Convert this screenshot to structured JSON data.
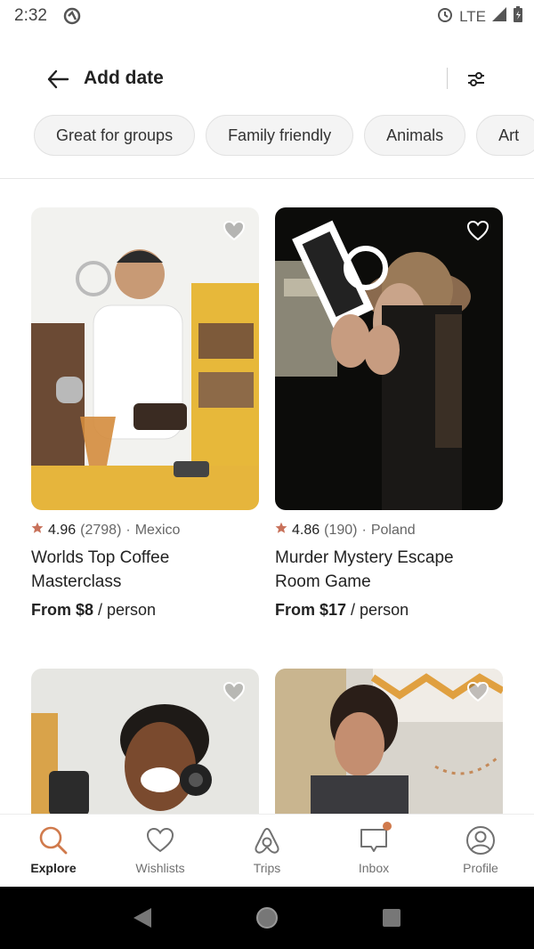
{
  "status_bar": {
    "time": "2:32",
    "network": "LTE"
  },
  "header": {
    "title": "Add date"
  },
  "chips": [
    "Great for groups",
    "Family friendly",
    "Animals",
    "Art"
  ],
  "colors": {
    "accent": "#d07a4c",
    "star": "#c8715a"
  },
  "cards": [
    {
      "rating": "4.96",
      "reviews": "(2798)",
      "country": "Mexico",
      "title_line1": "Worlds Top Coffee",
      "title_line2": "Masterclass",
      "price_from": "From $8",
      "price_unit": " / person"
    },
    {
      "rating": "4.86",
      "reviews": "(190)",
      "country": "Poland",
      "title_line1": "Murder Mystery Escape",
      "title_line2": "Room Game",
      "price_from": "From $17",
      "price_unit": " / person"
    },
    {
      "rating": "",
      "reviews": "",
      "country": "",
      "title_line1": "",
      "title_line2": "",
      "price_from": "",
      "price_unit": ""
    },
    {
      "rating": "",
      "reviews": "",
      "country": "",
      "title_line1": "",
      "title_line2": "",
      "price_from": "",
      "price_unit": ""
    }
  ],
  "bottom_nav": [
    {
      "label": "Explore",
      "icon": "search-icon",
      "active": true
    },
    {
      "label": "Wishlists",
      "icon": "heart-icon",
      "active": false
    },
    {
      "label": "Trips",
      "icon": "airbnb-logo-icon",
      "active": false
    },
    {
      "label": "Inbox",
      "icon": "message-icon",
      "active": false
    },
    {
      "label": "Profile",
      "icon": "profile-icon",
      "active": false
    }
  ]
}
